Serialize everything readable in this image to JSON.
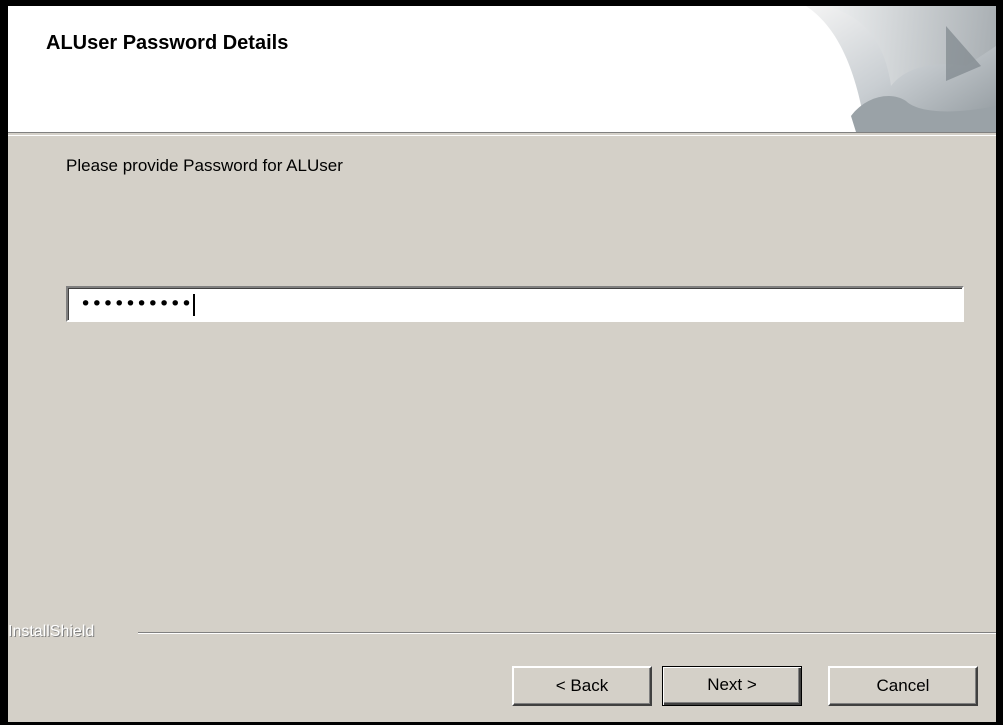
{
  "header": {
    "title": "ALUser Password Details"
  },
  "body": {
    "prompt": "Please provide Password for ALUser",
    "password_value": "••••••••••"
  },
  "footer": {
    "brand": "InstallShield",
    "back_label": "< Back",
    "next_label": "Next >",
    "cancel_label": "Cancel"
  },
  "colors": {
    "dialog_bg": "#d4d0c8",
    "header_bg": "#ffffff"
  }
}
